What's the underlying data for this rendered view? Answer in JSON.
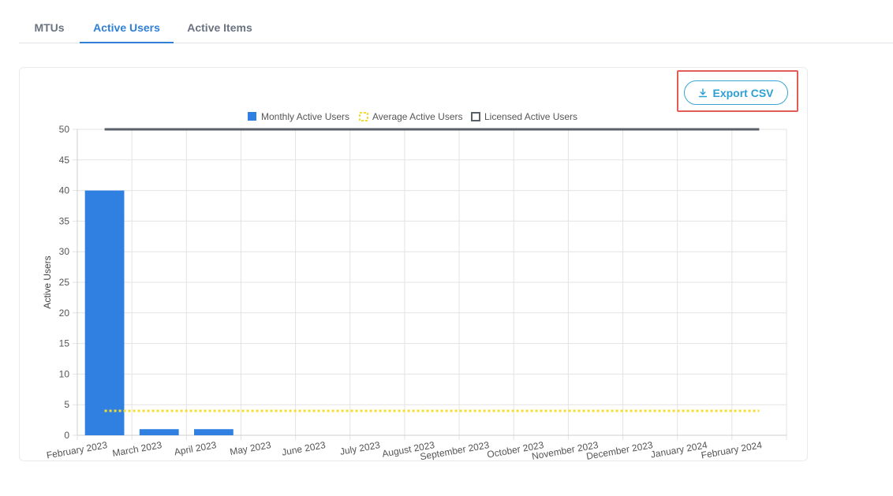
{
  "tabs": [
    {
      "label": "MTUs",
      "active": false
    },
    {
      "label": "Active Users",
      "active": true
    },
    {
      "label": "Active Items",
      "active": false
    }
  ],
  "toolbar": {
    "export_label": "Export CSV",
    "export_icon": "download-icon"
  },
  "colors": {
    "accent": "#2f80d6",
    "bar": "#2f80e0",
    "average_line": "#f5dc2e",
    "licensed_line": "#5a6169",
    "highlight": "#e35d56",
    "export": "#2c9fd4"
  },
  "chart_data": {
    "type": "bar",
    "categories": [
      "February 2023",
      "March 2023",
      "April 2023",
      "May 2023",
      "June 2023",
      "July 2023",
      "August 2023",
      "September 2023",
      "October 2023",
      "November 2023",
      "December 2023",
      "January 2024",
      "February 2024"
    ],
    "series": [
      {
        "name": "Monthly Active Users",
        "type": "bar",
        "values": [
          40,
          1,
          1,
          0,
          0,
          0,
          0,
          0,
          0,
          0,
          0,
          0,
          0
        ]
      },
      {
        "name": "Average Active Users",
        "type": "line",
        "style": "dotted",
        "values": [
          4,
          4,
          4,
          4,
          4,
          4,
          4,
          4,
          4,
          4,
          4,
          4,
          4
        ]
      },
      {
        "name": "Licensed Active Users",
        "type": "line",
        "style": "solid",
        "values": [
          50,
          50,
          50,
          50,
          50,
          50,
          50,
          50,
          50,
          50,
          50,
          50,
          50
        ]
      }
    ],
    "ylabel": "Active Users",
    "ylim": [
      0,
      50
    ],
    "yticks": [
      0,
      5,
      10,
      15,
      20,
      25,
      30,
      35,
      40,
      45,
      50
    ],
    "grid": true,
    "legend": "top-center"
  }
}
